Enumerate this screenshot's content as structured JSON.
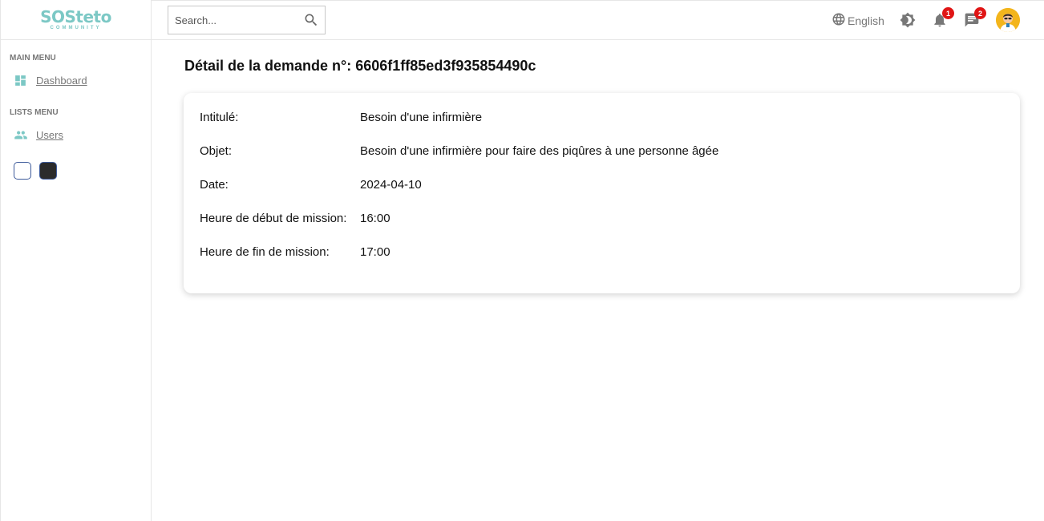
{
  "app": {
    "logo_main": "SOSteto",
    "logo_sub": "COMMUNITY"
  },
  "sidebar": {
    "main_menu_title": "MAIN MENU",
    "lists_menu_title": "LISTS MENU",
    "items": [
      {
        "label": "Dashboard",
        "icon": "dashboard-icon"
      },
      {
        "label": "Users",
        "icon": "users-icon"
      }
    ],
    "theme_options": [
      "light",
      "dark"
    ]
  },
  "topbar": {
    "search_placeholder": "Search...",
    "language": "English",
    "notifications_count": "1",
    "messages_count": "2"
  },
  "main": {
    "title": "Détail de la demande n°: 6606f1ff85ed3f935854490c",
    "details": [
      {
        "key": "Intitulé:",
        "value": "Besoin d'une infirmière"
      },
      {
        "key": "Objet:",
        "value": "Besoin d'une infirmière pour faire des piqûres à une personne âgée"
      },
      {
        "key": "Date:",
        "value": "2024-04-10"
      },
      {
        "key": "Heure de début de mission:",
        "value": "16:00"
      },
      {
        "key": "Heure de fin de mission:",
        "value": "17:00"
      }
    ]
  },
  "colors": {
    "accent": "#7cc8c5",
    "badge": "#e01515",
    "avatar_bg": "#f3b51c",
    "dark_theme": "#2b2b2b"
  }
}
